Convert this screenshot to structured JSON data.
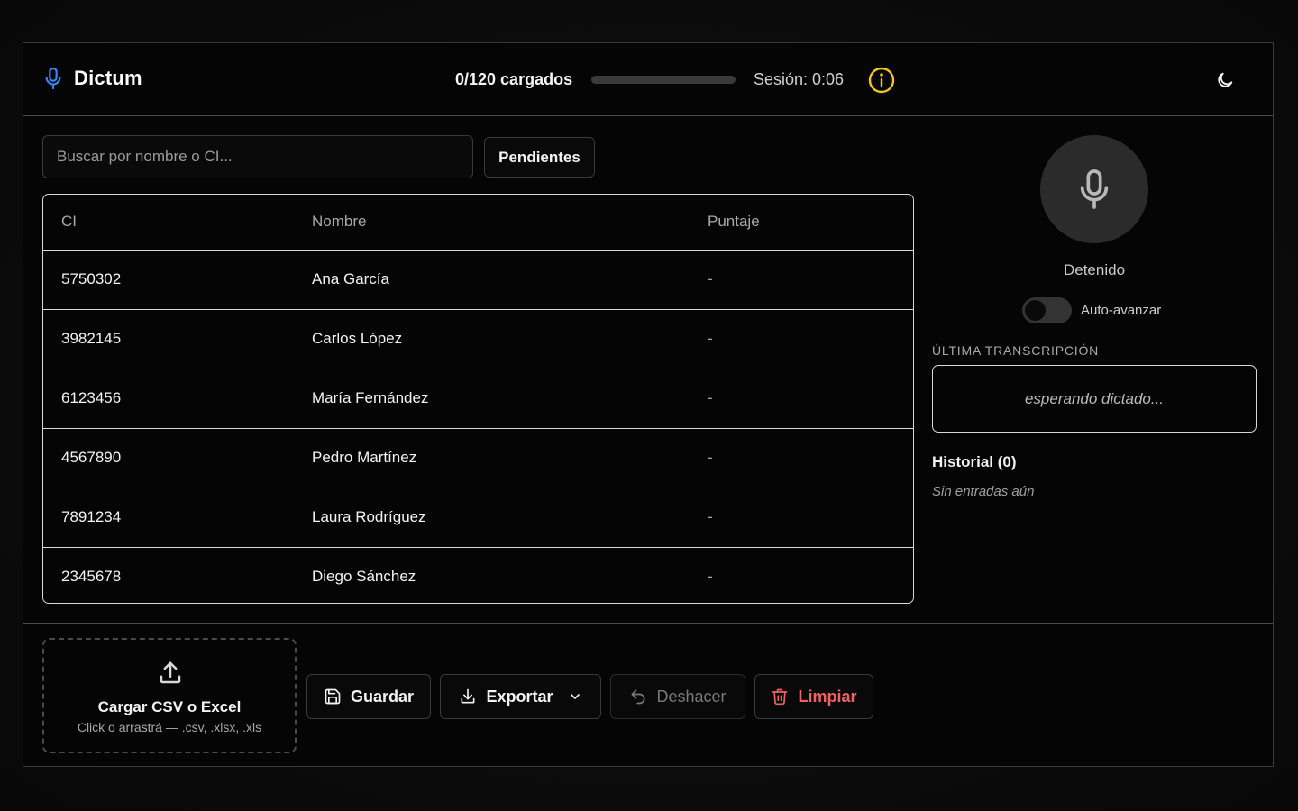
{
  "header": {
    "title": "Dictum",
    "progress_text": "0/120 cargados",
    "progress_fraction": 0,
    "session": "Sesión: 0:06",
    "accent": "#3b82f6",
    "info_color": "#f5c518"
  },
  "search": {
    "placeholder": "Buscar por nombre o CI..."
  },
  "filter": {
    "label": "Pendientes"
  },
  "table": {
    "headers": [
      "CI",
      "Nombre",
      "Puntaje"
    ],
    "rows": [
      {
        "ci": "5750302",
        "nombre": "Ana García",
        "puntaje": "-"
      },
      {
        "ci": "3982145",
        "nombre": "Carlos López",
        "puntaje": "-"
      },
      {
        "ci": "6123456",
        "nombre": "María Fernández",
        "puntaje": "-"
      },
      {
        "ci": "4567890",
        "nombre": "Pedro Martínez",
        "puntaje": "-"
      },
      {
        "ci": "7891234",
        "nombre": "Laura Rodríguez",
        "puntaje": "-"
      },
      {
        "ci": "2345678",
        "nombre": "Diego Sánchez",
        "puntaje": "-"
      }
    ]
  },
  "recorder": {
    "status": "Detenido",
    "auto_advance_label": "Auto-avanzar",
    "auto_advance": false
  },
  "transcript": {
    "label": "ÚLTIMA TRANSCRIPCIÓN",
    "placeholder": "esperando dictado..."
  },
  "history": {
    "title": "Historial (0)",
    "empty": "Sin entradas aún"
  },
  "upload": {
    "title": "Cargar CSV o Excel",
    "subtitle": "Click o arrastrá — .csv, .xlsx, .xls"
  },
  "actions": {
    "save": "Guardar",
    "export": "Exportar",
    "undo": "Deshacer",
    "clear": "Limpiar",
    "danger_color": "#f06262"
  }
}
